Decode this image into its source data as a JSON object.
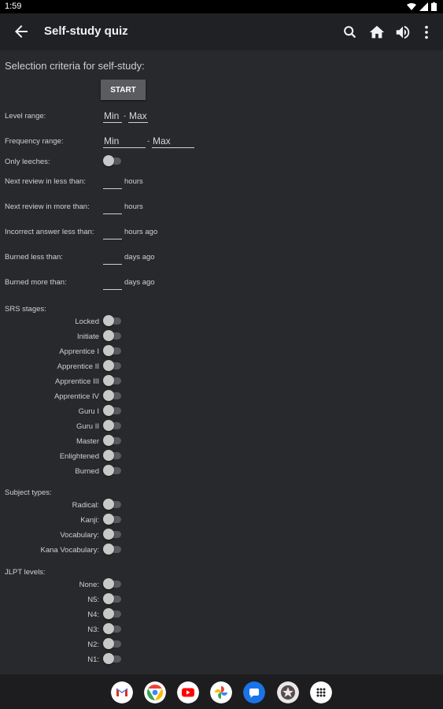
{
  "status": {
    "time": "1:59"
  },
  "appbar": {
    "title": "Self-study quiz"
  },
  "heading": "Selection criteria for self-study:",
  "start_label": "START",
  "level": {
    "label": "Level range:",
    "min": "Min",
    "sep": "-",
    "max": "Max"
  },
  "frequency": {
    "label": "Frequency range:",
    "min": "Min",
    "sep": "-",
    "max": "Max"
  },
  "leeches": {
    "label": "Only leeches:"
  },
  "filters": [
    {
      "label": "Next review in less than:",
      "value": "",
      "unit": "hours"
    },
    {
      "label": "Next review in more than:",
      "value": "",
      "unit": "hours"
    },
    {
      "label": "Incorrect answer less than:",
      "value": "",
      "unit": "hours ago"
    },
    {
      "label": "Burned less than:",
      "value": "",
      "unit": "days ago"
    },
    {
      "label": "Burned more than:",
      "value": "",
      "unit": "days ago"
    }
  ],
  "srs": {
    "title": "SRS stages:",
    "items": [
      "Locked",
      "Initiate",
      "Apprentice I",
      "Apprentice II",
      "Apprentice III",
      "Apprentice IV",
      "Guru I",
      "Guru II",
      "Master",
      "Enlightened",
      "Burned"
    ]
  },
  "subjects": {
    "title": "Subject types:",
    "items": [
      "Radical:",
      "Kanji:",
      "Vocabulary:",
      "Kana Vocabulary:"
    ]
  },
  "jlpt": {
    "title": "JLPT levels:",
    "items": [
      "None:",
      "N5:",
      "N4:",
      "N3:",
      "N2:",
      "N1:"
    ]
  },
  "colors": {
    "background": "#28292c",
    "appbar": "#202124",
    "button": "#5b5c5f"
  }
}
